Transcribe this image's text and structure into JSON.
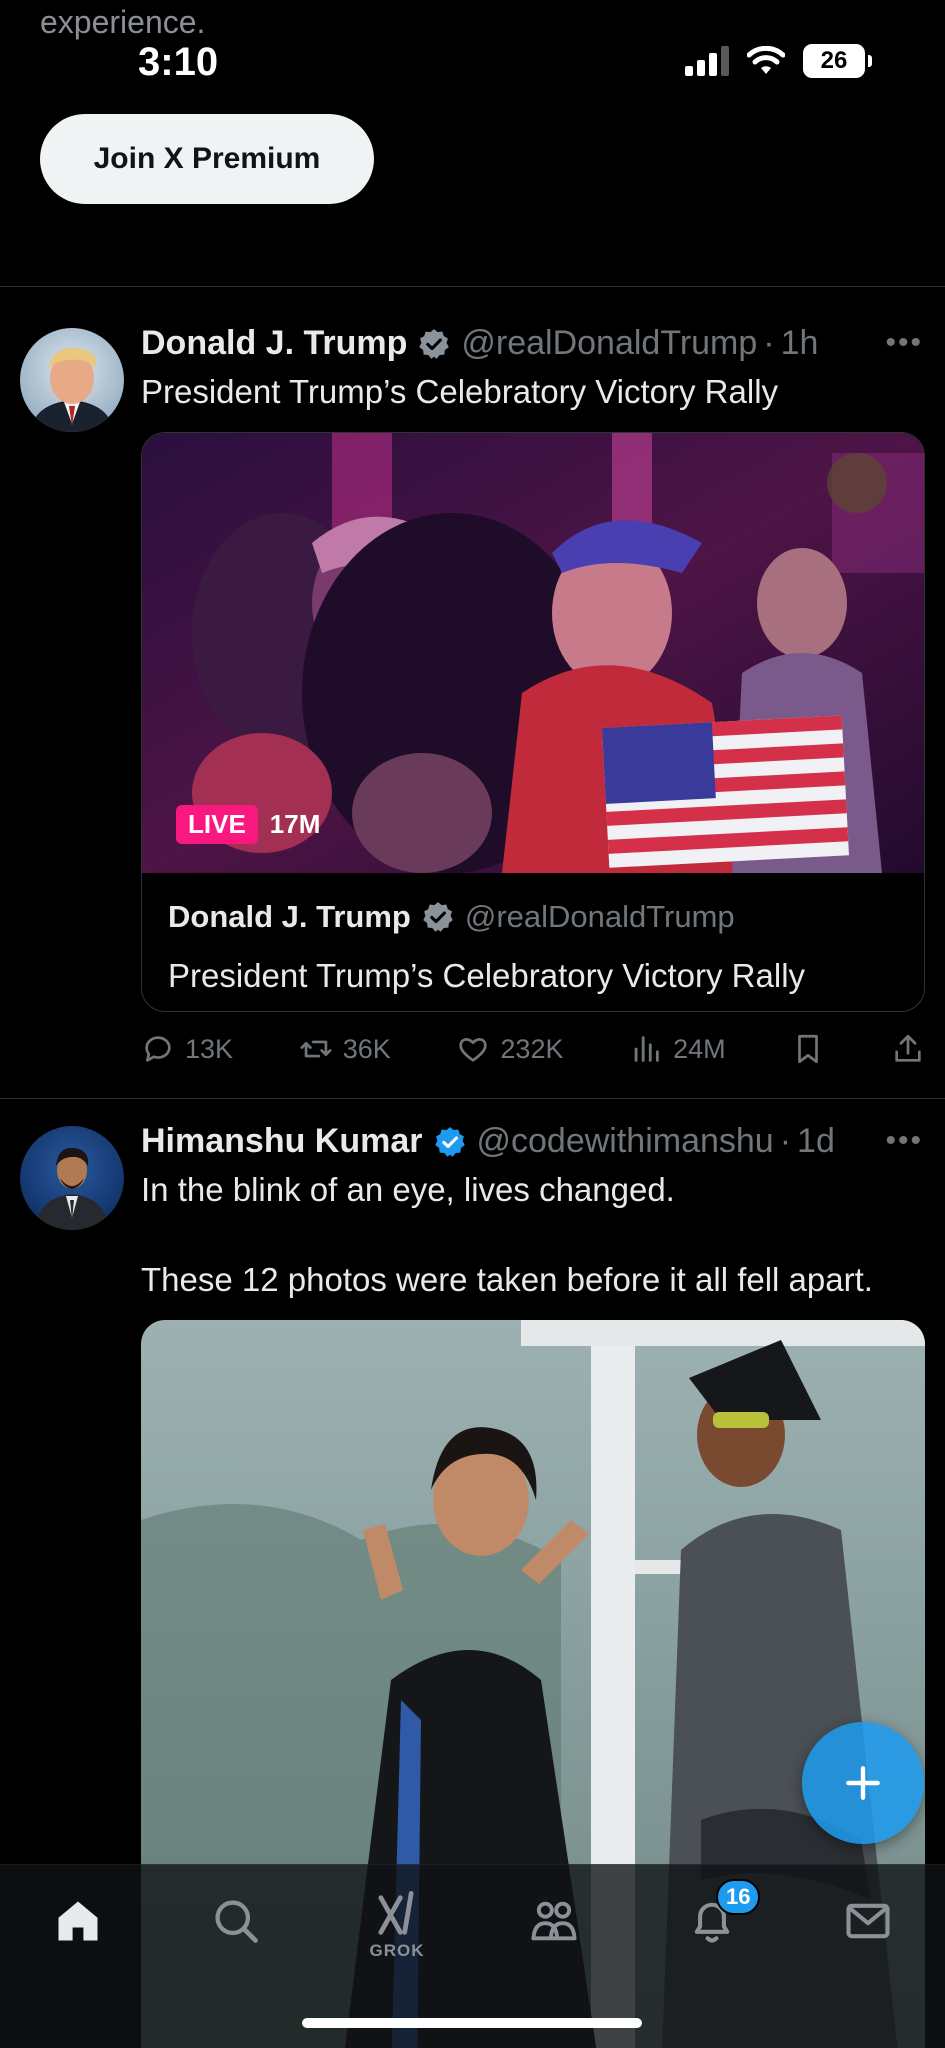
{
  "status_bar": {
    "fade_text": "experience.",
    "time": "3:10",
    "battery": "26"
  },
  "premium_button": {
    "label": "Join X Premium"
  },
  "posts": [
    {
      "name": "Donald J. Trump",
      "handle": "@realDonaldTrump",
      "time": "1h",
      "text": "President Trump’s Celebratory Victory Rally",
      "card": {
        "live_label": "LIVE",
        "viewers": "17M",
        "name": "Donald J. Trump",
        "handle": "@realDonaldTrump",
        "title": "President Trump’s Celebratory Victory Rally"
      },
      "stats": {
        "replies": "13K",
        "reposts": "36K",
        "likes": "232K",
        "views": "24M"
      }
    },
    {
      "name": "Himanshu Kumar",
      "handle": "@codewithimanshu",
      "time": "1d",
      "text_line1": "In the blink of an eye, lives changed.",
      "text_line2": "These 12 photos were taken before it all fell apart."
    }
  ],
  "tab_bar": {
    "grok_label": "GROK",
    "notifications_count": "16"
  },
  "colors": {
    "accent": "#1d9bf0",
    "live": "#f91880",
    "muted": "#71767b",
    "background": "#000000"
  }
}
